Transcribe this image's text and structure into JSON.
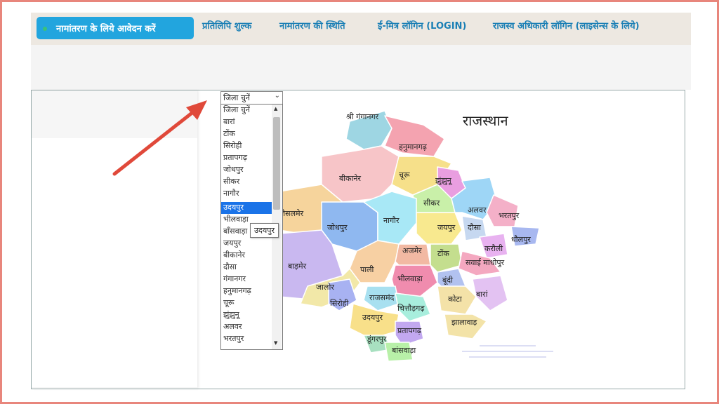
{
  "nav": {
    "primary": "नामांतरण के लिये आवेदन करें",
    "items": [
      "प्रतिलिपि शुल्क",
      "नामांतरण की स्थिति",
      "ई-मित्र लॉगिन (LOGIN)",
      "राजस्व अधिकारी लॉगिन (लाइसेन्स के लिये)"
    ]
  },
  "district_select": {
    "value": "जिला चुनें",
    "options": [
      "जिला चुनें",
      "बारां",
      "टोंक",
      "सिरोही",
      "प्रतापगढ़",
      "जोधपुर",
      "सीकर",
      "नागौर",
      "उदयपुर",
      "भीलवाड़ा",
      "बाँसवाड़ा",
      "जयपुर",
      "बीकानेर",
      "दौसा",
      "गंगानगर",
      "हनुमानगढ़",
      "चूरू",
      "झुंझुनू",
      "अलवर",
      "भरतपुर"
    ],
    "highlighted": "उदयपुर",
    "tooltip": "उदयपुर"
  },
  "map": {
    "title": "राजस्थान",
    "districts": [
      "श्री गंगानगर",
      "हनुमानगढ़",
      "बीकानेर",
      "चूरू",
      "झुंझुनू",
      "सीकर",
      "अलवर",
      "भरतपुर",
      "धौलपुर",
      "जैसलमेर",
      "जोधपुर",
      "नागौर",
      "जयपुर",
      "दौसा",
      "करौली",
      "अजमेर",
      "टोंक",
      "सवाई माधोपुर",
      "बाड़मेर",
      "पाली",
      "भीलवाड़ा",
      "बूंदी",
      "बारां",
      "जालोर",
      "सिरोही",
      "राजसमंद",
      "चित्तौड़गढ़",
      "कोटा",
      "उदयपुर",
      "प्रतापगढ़",
      "झालावाड़",
      "डूंगरपुर",
      "बांसवाड़ा"
    ]
  },
  "colors": {
    "accent": "#22a5de",
    "link": "#1a7fb5",
    "arrow": "#e0493a",
    "selected": "#1a73e8"
  }
}
